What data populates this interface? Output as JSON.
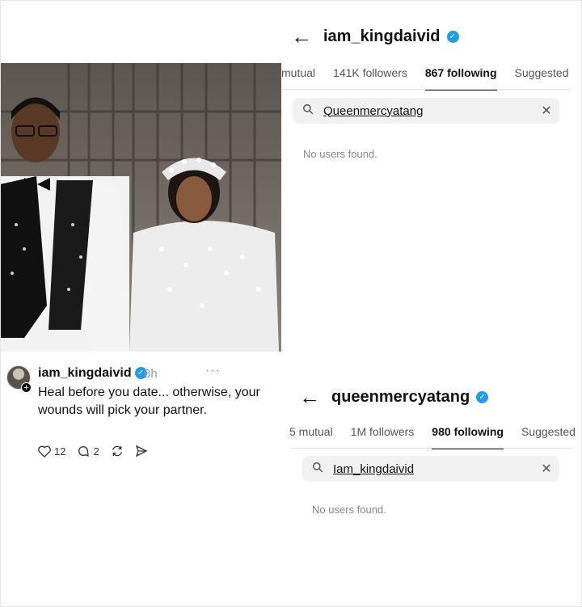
{
  "post": {
    "username": "iam_kingdaivid",
    "time": "8h",
    "more": "···",
    "text": "Heal before you date... otherwise, your wounds will pick your partner.",
    "likes": "12",
    "comments": "2"
  },
  "panel_top": {
    "handle": "iam_kingdaivid",
    "tabs": [
      "mutual",
      "141K followers",
      "867 following",
      "Suggested"
    ],
    "active_tab": "867 following",
    "search_value": "Queenmercyatang",
    "empty_text": "No users found."
  },
  "panel_bottom": {
    "handle": "queenmercyatang",
    "tabs": [
      "5 mutual",
      "1M followers",
      "980 following",
      "Suggested"
    ],
    "active_tab": "980 following",
    "search_value": "Iam_kingdaivid",
    "empty_text": "No users found."
  },
  "colors": {
    "verified": "#1d9bf0",
    "search_bg": "#f1f1f1"
  }
}
